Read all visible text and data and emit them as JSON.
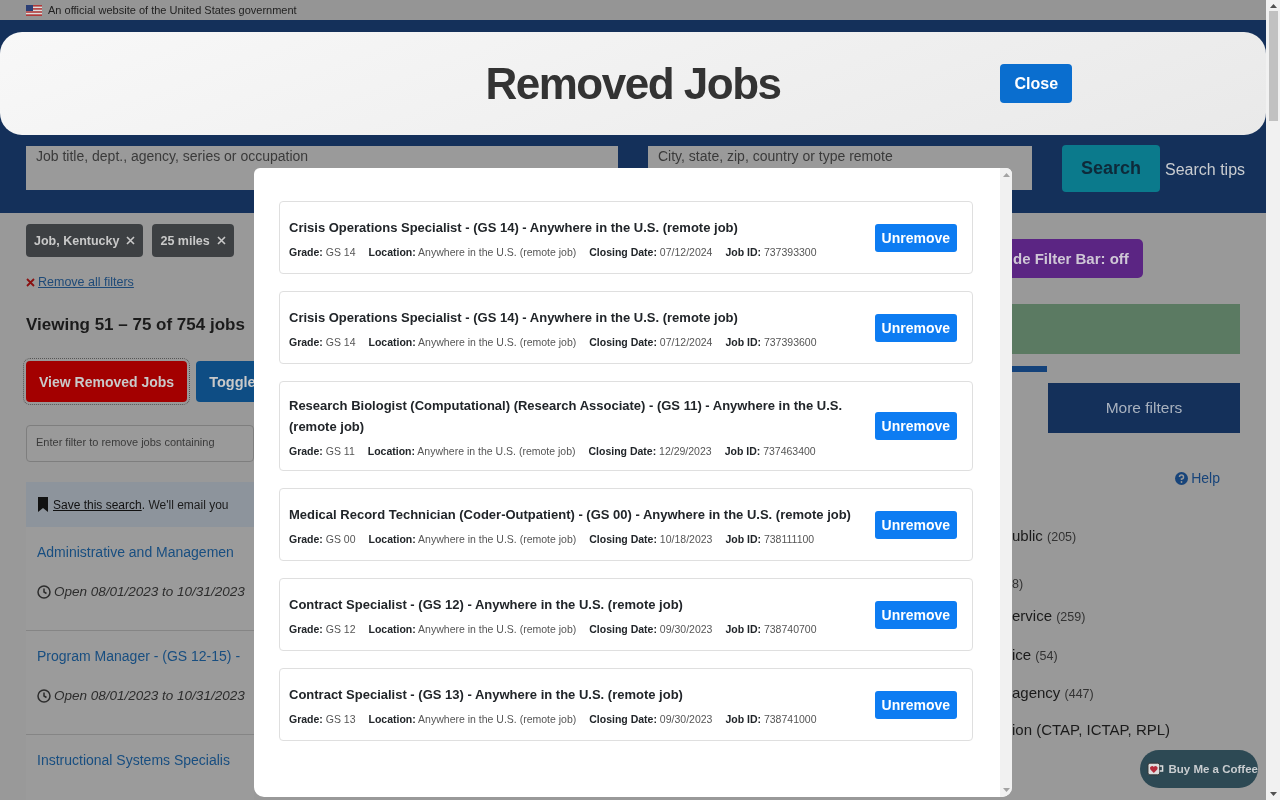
{
  "gov_banner": {
    "text": "An official website of the United States government"
  },
  "search": {
    "keywords_placeholder": "Job title, dept., agency, series or occupation",
    "location_placeholder": "City, state, zip, country or type remote",
    "search_button": "Search",
    "search_tips": "Search tips"
  },
  "filter_chips": [
    {
      "label": "Job, Kentucky"
    },
    {
      "label": "25 miles"
    }
  ],
  "remove_all_filters": "Remove all filters",
  "results_count": "Viewing 51 – 75 of 754 jobs",
  "actions": [
    {
      "label": "View Removed Jobs",
      "kind": "danger"
    },
    {
      "label": "Toggle",
      "kind": "primary"
    }
  ],
  "exclude_filter": {
    "placeholder": "Enter filter to remove jobs containing"
  },
  "save_search": {
    "link": "Save this search",
    "text": ". We'll email you"
  },
  "jobs": [
    {
      "title": "Administrative and Managemen",
      "dates": "Open 08/01/2023 to 10/31/2023"
    },
    {
      "title": "Program Manager - (GS 12-15) -",
      "dates": "Open 08/01/2023 to 10/31/2023"
    },
    {
      "title": "Instructional Systems Specialis"
    }
  ],
  "sidebar": {
    "filter_bar_toggle": "de Filter Bar: off",
    "more_filters": "More filters",
    "help": "Help",
    "facets": [
      {
        "label": "ublic",
        "count": "(205)"
      },
      {
        "count": "8)"
      },
      {
        "label": "ervice",
        "count": "(259)"
      },
      {
        "label": "ice",
        "count": "(54)"
      },
      {
        "label": "agency",
        "count": "(447)"
      },
      {
        "label": "ion (CTAP, ICTAP, RPL)"
      }
    ]
  },
  "buy_coffee": "Buy Me a Coffee",
  "removed_header": {
    "title": "Removed Jobs",
    "close": "Close"
  },
  "removed_jobs": [
    {
      "title": "Crisis Operations Specialist - (GS 14) - Anywhere in the U.S. (remote job)",
      "fields": [
        {
          "label": "Grade:",
          "value": "GS 14"
        },
        {
          "label": "Location:",
          "value": "Anywhere in the U.S. (remote job)"
        },
        {
          "label": "Closing Date:",
          "value": "07/12/2024"
        },
        {
          "label": "Job ID:",
          "value": "737393300"
        }
      ],
      "action": "Unremove"
    },
    {
      "title": "Crisis Operations Specialist - (GS 14) - Anywhere in the U.S. (remote job)",
      "fields": [
        {
          "label": "Grade:",
          "value": "GS 14"
        },
        {
          "label": "Location:",
          "value": "Anywhere in the U.S. (remote job)"
        },
        {
          "label": "Closing Date:",
          "value": "07/12/2024"
        },
        {
          "label": "Job ID:",
          "value": "737393600"
        }
      ],
      "action": "Unremove"
    },
    {
      "title": "Research Biologist (Computational) (Research Associate) - (GS 11) - Anywhere in the U.S. (remote job)",
      "fields": [
        {
          "label": "Grade:",
          "value": "GS 11"
        },
        {
          "label": "Location:",
          "value": "Anywhere in the U.S. (remote job)"
        },
        {
          "label": "Closing Date:",
          "value": "12/29/2023"
        },
        {
          "label": "Job ID:",
          "value": "737463400"
        }
      ],
      "action": "Unremove"
    },
    {
      "title": "Medical Record Technician (Coder-Outpatient) - (GS 00) - Anywhere in the U.S. (remote job)",
      "fields": [
        {
          "label": "Grade:",
          "value": "GS 00"
        },
        {
          "label": "Location:",
          "value": "Anywhere in the U.S. (remote job)"
        },
        {
          "label": "Closing Date:",
          "value": "10/18/2023"
        },
        {
          "label": "Job ID:",
          "value": "738111100"
        }
      ],
      "action": "Unremove"
    },
    {
      "title": "Contract Specialist - (GS 12) - Anywhere in the U.S. (remote job)",
      "fields": [
        {
          "label": "Grade:",
          "value": "GS 12"
        },
        {
          "label": "Location:",
          "value": "Anywhere in the U.S. (remote job)"
        },
        {
          "label": "Closing Date:",
          "value": "09/30/2023"
        },
        {
          "label": "Job ID:",
          "value": "738740700"
        }
      ],
      "action": "Unremove"
    },
    {
      "title": "Contract Specialist - (GS 13) - Anywhere in the U.S. (remote job)",
      "fields": [
        {
          "label": "Grade:",
          "value": "GS 13"
        },
        {
          "label": "Location:",
          "value": "Anywhere in the U.S. (remote job)"
        },
        {
          "label": "Closing Date:",
          "value": "09/30/2023"
        },
        {
          "label": "Job ID:",
          "value": "738741000"
        }
      ],
      "action": "Unremove"
    }
  ]
}
